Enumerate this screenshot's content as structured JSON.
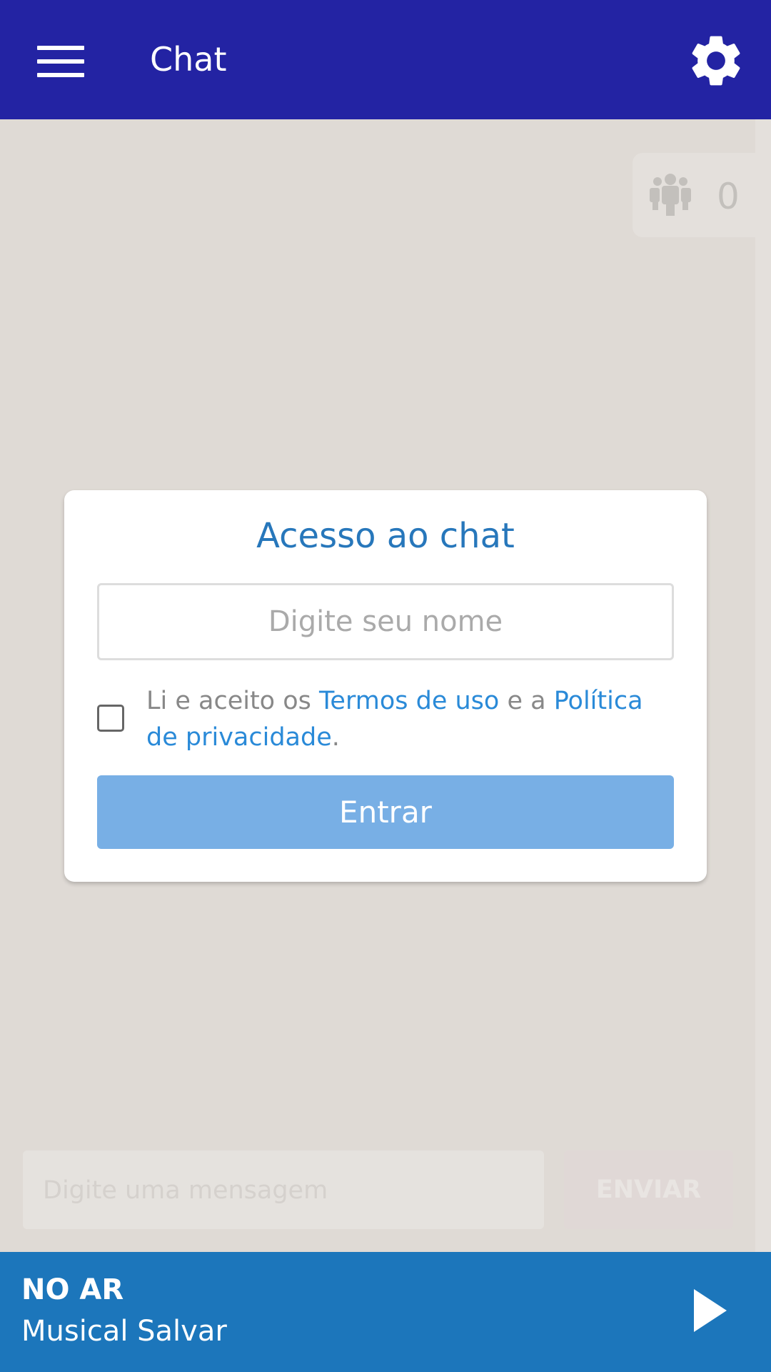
{
  "header": {
    "title": "Chat",
    "menu_icon": "hamburger-menu-icon",
    "settings_icon": "gear-icon"
  },
  "users_badge": {
    "icon": "users-group-icon",
    "count": "0"
  },
  "modal": {
    "title": "Acesso ao chat",
    "name_placeholder": "Digite seu nome",
    "terms": {
      "prefix": "Li e aceito os ",
      "terms_link": "Termos de uso",
      "middle": " e a ",
      "privacy_link": "Política de privacidade",
      "suffix": "."
    },
    "checkbox_checked": false,
    "enter_label": "Entrar"
  },
  "composer": {
    "placeholder": "Digite uma mensagem",
    "send_label": "ENVIAR"
  },
  "player": {
    "status": "NO AR",
    "program": "Musical Salvar",
    "play_icon": "play-icon"
  },
  "colors": {
    "header": "#2323a3",
    "accent": "#2777bb",
    "button": "#78afe5",
    "player": "#1c76bb"
  }
}
